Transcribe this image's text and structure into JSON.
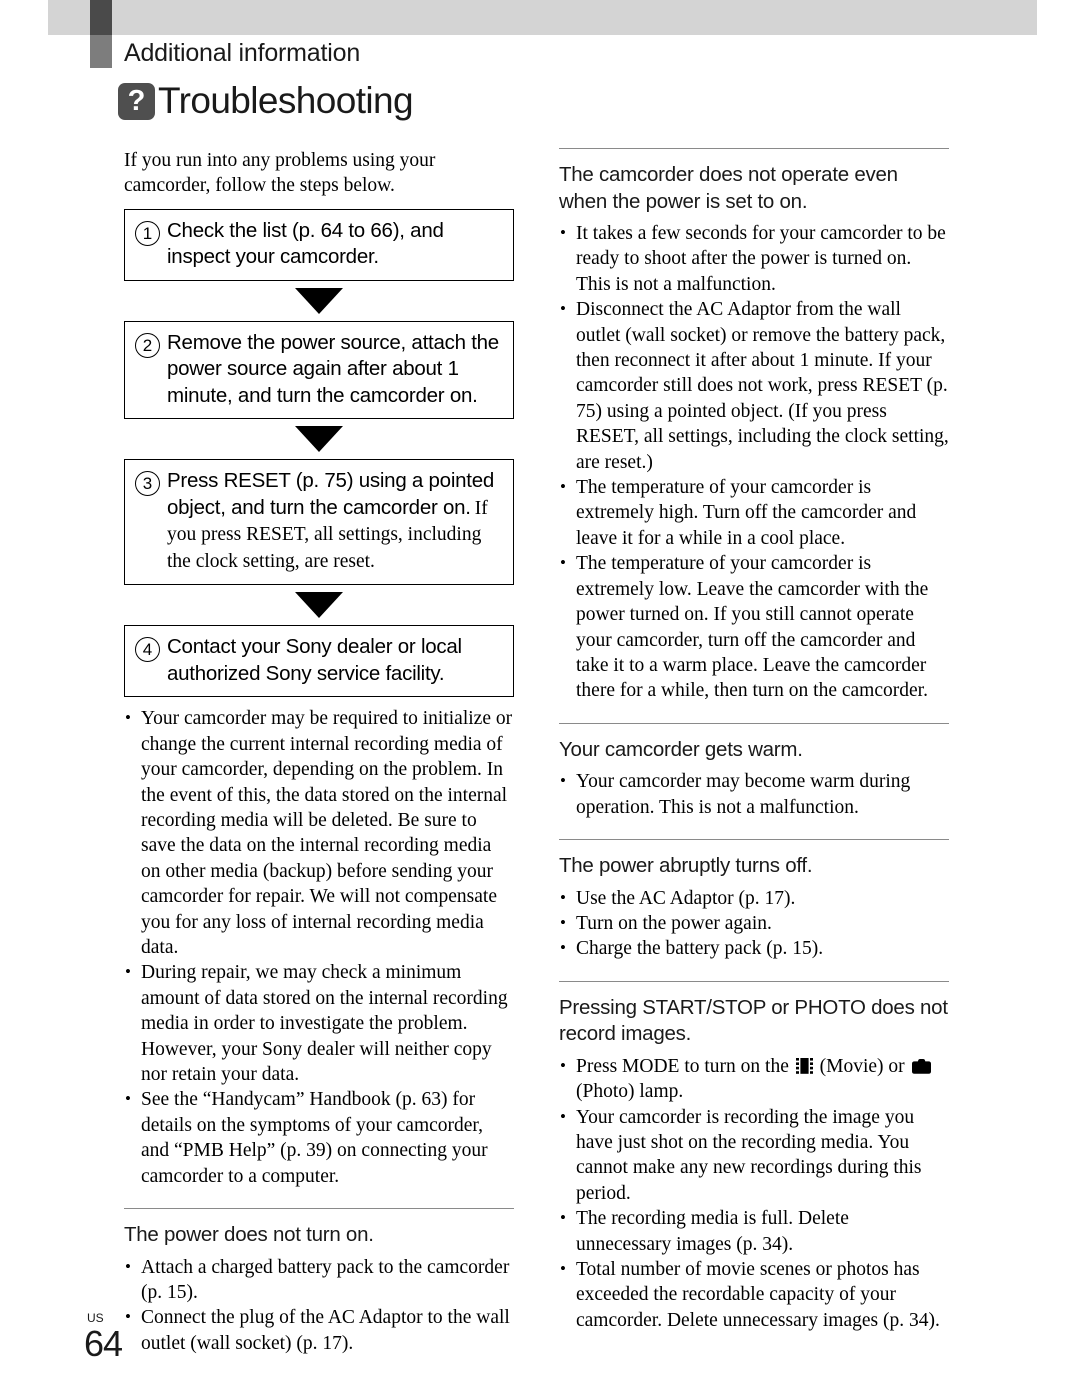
{
  "header": {
    "kicker": "Additional information",
    "badge_glyph": "?",
    "chapter_title": "Troubleshooting"
  },
  "left_column": {
    "intro": "If you run into any problems using your camcorder, follow the steps below.",
    "steps": [
      {
        "number": "1",
        "text": "Check the list (p. 64 to 66), and inspect your camcorder.",
        "sub": ""
      },
      {
        "number": "2",
        "text": "Remove the power source, attach the power source again after about 1 minute, and turn the camcorder on.",
        "sub": ""
      },
      {
        "number": "3",
        "text": "Press RESET (p. 75) using a pointed object, and turn the camcorder on.",
        "sub": "If you press RESET, all settings, including the clock setting, are reset."
      },
      {
        "number": "4",
        "text": "Contact your Sony dealer or local authorized Sony service facility.",
        "sub": ""
      }
    ],
    "notes": [
      "Your camcorder may be required to initialize or change the current internal recording media of your camcorder, depending on the problem. In the event of this, the data stored on the internal recording media will be deleted. Be sure to save the data on the internal recording media on other media (backup) before sending your camcorder for repair. We will not compensate you for any loss of internal recording media data.",
      "During repair, we may check a minimum amount of data stored on the internal recording media in order to investigate the problem. However, your Sony dealer will neither copy nor retain your data.",
      "See the “Handycam” Handbook (p. 63) for details on the symptoms of your camcorder, and “PMB Help” (p. 39) on connecting your camcorder to a computer."
    ],
    "section": {
      "heading": "The power does not turn on.",
      "items": [
        "Attach a charged battery pack to the camcorder (p. 15).",
        "Connect the plug of the AC Adaptor to the wall outlet (wall socket) (p. 17)."
      ]
    }
  },
  "right_column": {
    "sections": [
      {
        "heading": "The camcorder does not operate even when the power is set to on.",
        "items": [
          "It takes a few seconds for your camcorder to be ready to shoot after the power is turned on. This is not a malfunction.",
          "Disconnect the AC Adaptor from the wall outlet (wall socket) or remove the battery pack, then reconnect it after about 1 minute. If your camcorder still does not work, press RESET (p. 75) using a pointed object. (If you press RESET, all settings, including the clock setting, are reset.)",
          "The temperature of your camcorder is extremely high. Turn off the camcorder and leave it for a while in a cool place.",
          "The temperature of your camcorder is extremely low. Leave the camcorder with the power turned on. If you still cannot operate your camcorder, turn off the camcorder and take it to a warm place. Leave the camcorder there for a while, then turn on the camcorder."
        ]
      },
      {
        "heading": "Your camcorder gets warm.",
        "items": [
          "Your camcorder may become warm during operation. This is not a malfunction."
        ]
      },
      {
        "heading": "The power abruptly turns off.",
        "items": [
          "Use the AC Adaptor (p. 17).",
          "Turn on the power again.",
          "Charge the battery pack (p. 15)."
        ]
      },
      {
        "heading": "Pressing START/STOP or PHOTO does not record images.",
        "items": []
      }
    ],
    "mode_bullet": {
      "prefix": "Press MODE to turn on the ",
      "movie_label": " (Movie) or ",
      "photo_label": " (Photo) lamp."
    },
    "final_items": [
      "Your camcorder is recording the image you have just shot on the recording media. You cannot make any new recordings during this period.",
      "The recording media is full. Delete unnecessary images (p. 34).",
      "Total number of movie scenes or photos has exceeded the recordable capacity of your camcorder. Delete unnecessary images (p. 34)."
    ]
  },
  "footer": {
    "region": "US",
    "page_number": "64"
  },
  "colors": {
    "bar_light": "#d4d4d4",
    "bar_dark": "#4a4a4a",
    "bar_mid": "#7d7d7d",
    "badge": "#4f4f4f",
    "rule": "#8a8a8a",
    "text": "#000000"
  }
}
